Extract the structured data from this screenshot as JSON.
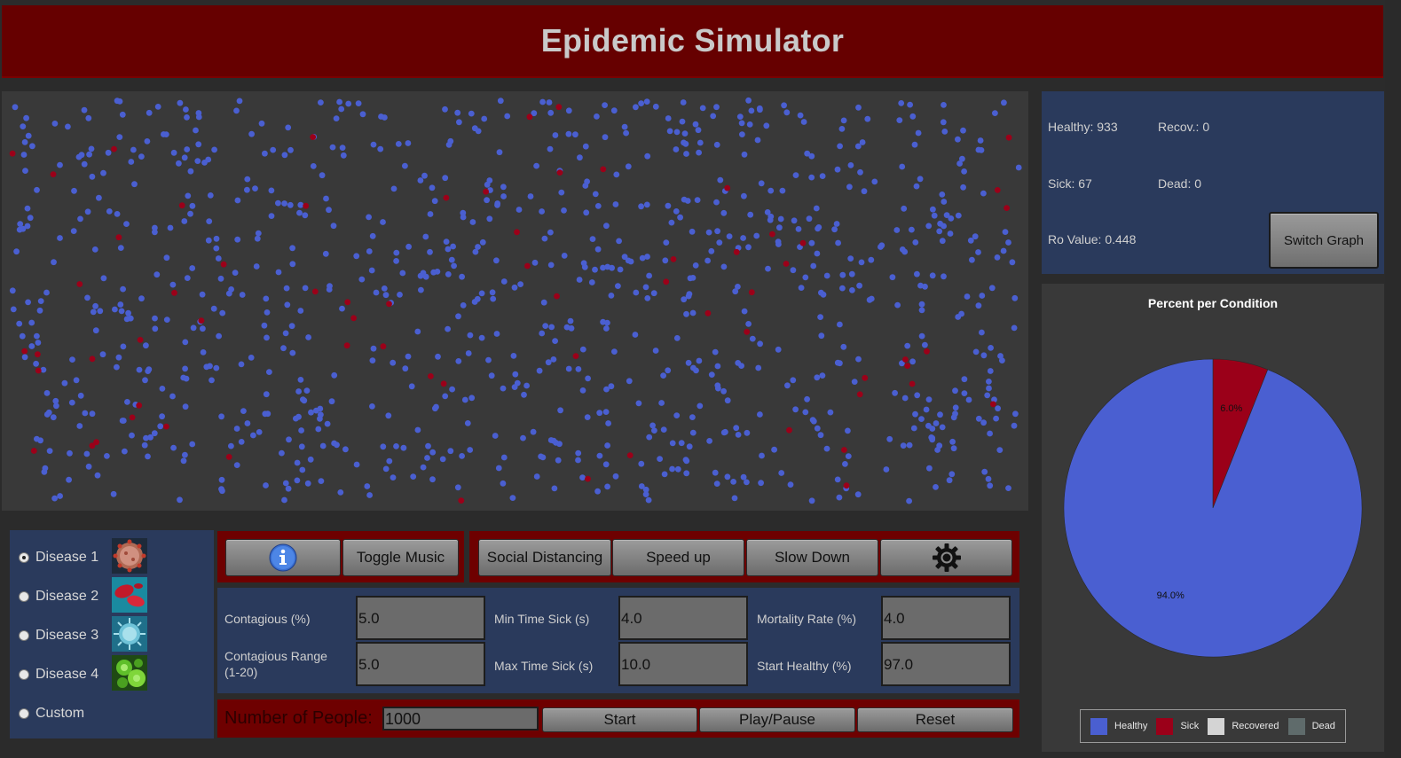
{
  "title": "Epidemic Simulator",
  "colors": {
    "header_bg": "#660000",
    "healthy": "#4a5fd1",
    "sick": "#9b0019",
    "recovered": "#d4d4d4",
    "dead": "#5f6b6b",
    "panel_blue": "#2a3a5c",
    "button_bar_red": "#6e0000"
  },
  "simulation": {
    "people_total": 1000,
    "healthy_count": 933,
    "sick_count": 67
  },
  "stats": {
    "healthy": "Healthy: 933",
    "recovered": "Recov.: 0",
    "sick": "Sick: 67",
    "dead": "Dead: 0",
    "ro_value": "Ro Value: 0.448",
    "switch_graph": "Switch Graph"
  },
  "chart_data": {
    "type": "pie",
    "title": "Percent per Condition",
    "labels": [
      "Healthy",
      "Sick",
      "Recovered",
      "Dead"
    ],
    "values": [
      94.0,
      6.0,
      0,
      0
    ],
    "value_labels": [
      "94.0%",
      "6.0%"
    ],
    "colors": [
      "#4a5fd1",
      "#9b0019",
      "#d4d4d4",
      "#5f6b6b"
    ],
    "legend_position": "bottom"
  },
  "diseases": [
    {
      "label": "Disease 1",
      "checked": true,
      "icon": "coronavirus-image"
    },
    {
      "label": "Disease 2",
      "checked": false,
      "icon": "red-bacteria-image"
    },
    {
      "label": "Disease 3",
      "checked": false,
      "icon": "blue-virus-image"
    },
    {
      "label": "Disease 4",
      "checked": false,
      "icon": "green-virus-image"
    },
    {
      "label": "Custom",
      "checked": false,
      "icon": ""
    }
  ],
  "toolbar": {
    "info_icon": "info-icon",
    "toggle_music": "Toggle Music",
    "social_distancing": "Social Distancing",
    "speed_up": "Speed up",
    "slow_down": "Slow Down",
    "settings_icon": "gear-icon"
  },
  "params": {
    "contagious_label": "Contagious (%)",
    "contagious_value": "5.0",
    "range_label_1": "Contagious Range",
    "range_label_2": "(1-20)",
    "range_value": "5.0",
    "min_sick_label": "Min Time Sick (s)",
    "min_sick_value": "4.0",
    "max_sick_label": "Max Time Sick (s)",
    "max_sick_value": "10.0",
    "mortality_label": "Mortality Rate (%)",
    "mortality_value": "4.0",
    "start_healthy_label": "Start Healthy (%)",
    "start_healthy_value": "97.0"
  },
  "bottom": {
    "people_label": "Number of People:",
    "people_value": "1000",
    "start": "Start",
    "play_pause": "Play/Pause",
    "reset": "Reset"
  }
}
